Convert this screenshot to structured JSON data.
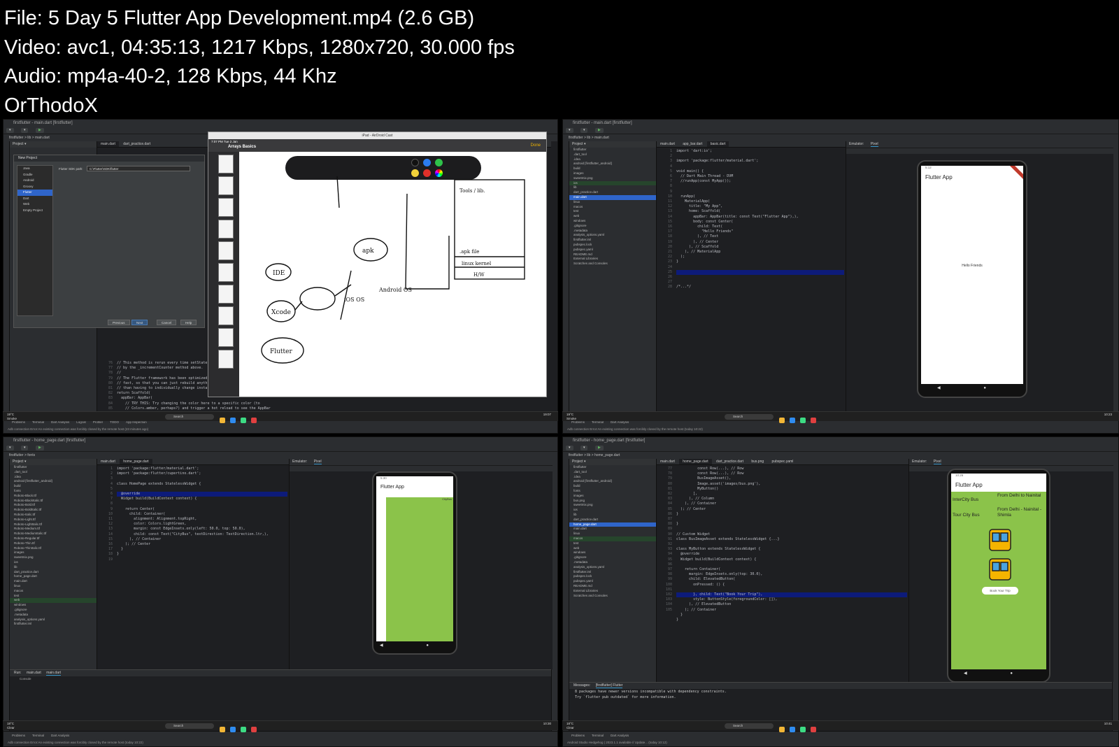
{
  "header": {
    "file_line": "File: 5  Day 5 Flutter App Development.mp4 (2.6 GB)",
    "video_line": "Video: avc1, 04:35:13, 1217 Kbps, 1280x720, 30.000 fps",
    "audio_line": "Audio: mp4a-40-2, 128 Kbps, 44 Khz",
    "uploader": "OrThodoX"
  },
  "colors": {
    "background": "#000000",
    "ide_dark": "#1e1f22",
    "ide_panel": "#2b2d30",
    "selection": "#2f65ca",
    "phone_green": "#8bc34a"
  },
  "panel1": {
    "title": "firstflutter - main.dart [firstflutter]",
    "crumb": "firstflutter > lib > main.dart",
    "tabs": [
      "main.dart",
      "dart_practice.dart"
    ],
    "dialog": {
      "title": "New Project",
      "items": [
        "Java",
        "Gradle",
        "Android",
        "Groovy",
        "Flutter",
        "Dart",
        "Web",
        "Empty Project"
      ],
      "sdk_label": "Flutter SDK path:",
      "sdk_value": "C:\\Flutter\\SDK\\flutter",
      "buttons": [
        "Previous",
        "Next",
        "Cancel",
        "Help"
      ]
    },
    "ipad": {
      "window_title": "iPad - AirDroid Cast",
      "status": "7:07 PM  Tue 2 Jan",
      "doc_title": "Arrays Basics",
      "done": "Done"
    },
    "code_lines": [
      "// This method is rerun every time setState is called",
      "// by the _incrementCounter method above.",
      "//",
      "// The Flutter framework has been optimized to make rerunning build methods",
      "// fast, so that you can just rebuild anything that needs updating rather",
      "// than having to individually change instances of widgets.",
      "return Scaffold(",
      "  appBar: AppBar(",
      "    // TRY THIS: Try changing the color here to a specific color (to",
      "    // Colors.amber, perhaps?) and trigger a hot reload to see the AppBar",
      "    // change color while the other colors stay the same."
    ],
    "line_numbers": [
      "76",
      "77",
      "78",
      "79",
      "80",
      "81",
      "82",
      "83",
      "84",
      "85",
      "86"
    ],
    "bottom_tabs": [
      "Problems",
      "Terminal",
      "Dart Analysis",
      "Logcat",
      "Profiler",
      "TODO",
      "App Inspection"
    ],
    "status": "Adb connection Error:An existing connection was forcibly closed by the remote host (23 minutes ago)"
  },
  "panel2": {
    "title": "firstflutter - main.dart [firstflutter]",
    "crumb": "firstflutter > lib > main.dart",
    "tabs": [
      "main.dart",
      "app_bar.dart",
      "basic.dart"
    ],
    "emu_tabs": [
      "Emulator:",
      "Pixel"
    ],
    "tree": [
      "firstflutter",
      ".dart_tool",
      ".idea",
      "android [firstflutter_android]",
      "build",
      "images",
      "sweetmix.png",
      "ios",
      "lib",
      "dart_practice.dart",
      "main.dart",
      "linux",
      "macos",
      "test",
      "web",
      "windows",
      ".gitignore",
      ".metadata",
      "analysis_options.yaml",
      "firstflutter.iml",
      "pubspec.lock",
      "pubspec.yaml",
      "README.md",
      "External Libraries",
      "Scratches and Consoles"
    ],
    "code_lines": [
      "import 'dart:io';",
      "",
      "import 'package:flutter/material.dart';",
      "",
      "void main() {",
      "  // Dart Main Thread - DVM",
      "  //runApp(const MyApp());",
      "",
      "",
      "  runApp(",
      "    MaterialApp(",
      "      title: \"My App\",",
      "      home: Scaffold(",
      "        appBar: AppBar(title: const Text(\"Flutter App\"),),",
      "        body: const Center(",
      "          child: Text(",
      "            \"Hello Friends\"",
      "          ), // Text",
      "        ), // Center",
      "      ), // Scaffold",
      "    ), // MaterialApp",
      "  );",
      "}",
      "",
      "",
      "",
      "",
      "/*...*/"
    ],
    "phone": {
      "app_title": "Flutter App",
      "body": "Hello Friends",
      "clock": "5:12"
    },
    "status": "Adb connection Error:An existing connection was forcibly closed by the remote host (today 10:22)"
  },
  "panel3": {
    "title": "firstflutter - home_page.dart [firstflutter]",
    "crumb": "firstflutter > fonts",
    "tabs": [
      "main.dart",
      "home_page.dart"
    ],
    "tree": [
      "firstflutter",
      ".dart_tool",
      ".idea",
      "android [firstflutter_android]",
      "build",
      "fonts",
      "Roboto-Black.ttf",
      "Roboto-BlackItalic.ttf",
      "Roboto-Bold.ttf",
      "Roboto-BoldItalic.ttf",
      "Roboto-Italic.ttf",
      "Roboto-Light.ttf",
      "Roboto-LightItalic.ttf",
      "Roboto-Medium.ttf",
      "Roboto-MediumItalic.ttf",
      "Roboto-Regular.ttf",
      "Roboto-Thin.ttf",
      "Roboto-ThinItalic.ttf",
      "images",
      "sweetmix.png",
      "ios",
      "lib",
      "dart_practice.dart",
      "home_page.dart",
      "main.dart",
      "linux",
      "macos",
      "test",
      "web",
      "windows",
      ".gitignore",
      ".metadata",
      "analysis_options.yaml",
      "firstflutter.iml"
    ],
    "code_lines": [
      "import 'package:flutter/material.dart';",
      "import 'package:flutter/cupertino.dart';",
      "",
      "class HomePage extends StatelessWidget {",
      "",
      "  @override",
      "  Widget build(BuildContext context) {",
      "",
      "    return Center(",
      "      child: Container(",
      "        alignment: Alignment.topRight,",
      "        color: Colors.lightGreen,",
      "        margin: const EdgeInsets.only(left: 50.0, top: 50.0),",
      "        child: const Text(\"CityBus\", textDirection: TextDirection.ltr,),",
      "      ), // Container",
      "    ); // Center",
      "  }",
      "}",
      ""
    ],
    "phone": {
      "app_title": "Flutter App",
      "corner_text": "CityBus",
      "clock": "5:30"
    },
    "run_tabs": [
      "Run:",
      "main.dart",
      "main.dart"
    ],
    "console": "Console",
    "status": "Adb connection Error:An existing connection was forcibly closed by the remote host (today 10:22)"
  },
  "panel4": {
    "title": "firstflutter - home_page.dart [firstflutter]",
    "crumb": "firstflutter > lib > home_page.dart",
    "tabs": [
      "main.dart",
      "home_page.dart",
      "dart_practice.dart",
      "bus.png",
      "pubspec.yaml"
    ],
    "tree": [
      "firstflutter",
      ".dart_tool",
      ".idea",
      "android [firstflutter_android]",
      "build",
      "fonts",
      "images",
      "bus.png",
      "sweetmix.png",
      "ios",
      "lib",
      "dart_practice.dart",
      "home_page.dart",
      "main.dart",
      "linux",
      "macos",
      "test",
      "web",
      "windows",
      ".gitignore",
      ".metadata",
      "analysis_options.yaml",
      "firstflutter.iml",
      "pubspec.lock",
      "pubspec.yaml",
      "README.md",
      "External Libraries",
      "Scratches and Consoles"
    ],
    "code_lines": [
      "          const Row(...), // Row",
      "          const Row(...), // Row",
      "          BusImageAsset(),",
      "          Image.asset('images/bus.png'),",
      "          MyButton()",
      "        ],",
      "      ), // Column",
      "    ), // Container",
      "  ); // Center",
      "}",
      "",
      "}",
      "",
      "// Custom Widget",
      "class BusImageAsset extends StatelessWidget {...}",
      "",
      "class MyButton extends StatelessWidget {",
      "  @override",
      "  Widget build(BuildContext context) {",
      "",
      "    return Container(",
      "      margin: EdgeInsets.only(top: 30.0),",
      "      child: ElevatedButton(",
      "        onPressed: () {",
      "",
      "        }, child: Text(\"Book Your Trip\"),",
      "        style: ButtonStyle(foregroundColor: []),",
      "      ), // ElevatedButton",
      "    ); // Container",
      "  }",
      "}"
    ],
    "line_numbers": [
      "77",
      "78",
      "79",
      "80",
      "81",
      "82",
      "83",
      "84",
      "85",
      "86",
      "87",
      "88",
      "89",
      "90",
      "91",
      "92",
      "93",
      "94",
      "95",
      "96",
      "97",
      "98",
      "99",
      "100",
      "101",
      "102",
      "103",
      "104",
      "105"
    ],
    "phone": {
      "app_title": "Flutter App",
      "left1": "InterCity Bus",
      "right1": "From Delhi to Nainital",
      "left2": "Tour City Bus",
      "right2": "From Delhi - Nainital - Shimla",
      "button": "Book Your Trip",
      "clock": "10:26"
    },
    "messages_tabs": [
      "Messages:",
      "[firstflutter] Flutter"
    ],
    "messages": [
      "8 packages have newer versions incompatible with dependency constraints.",
      "Try `flutter pub outdated` for more information."
    ],
    "status": "Android Studio Hedgehog | 2023.1.1 available // Update... (today 10:12)"
  },
  "taskbar": {
    "weather_temp": "19°C",
    "weather_desc": "Smoke",
    "weather_temp2": "18°C",
    "weather_desc2": "Clear",
    "search": "Search",
    "clock1": "19:07",
    "clock2": "10:23",
    "clock3": "10:30",
    "clock4": "10:41"
  }
}
